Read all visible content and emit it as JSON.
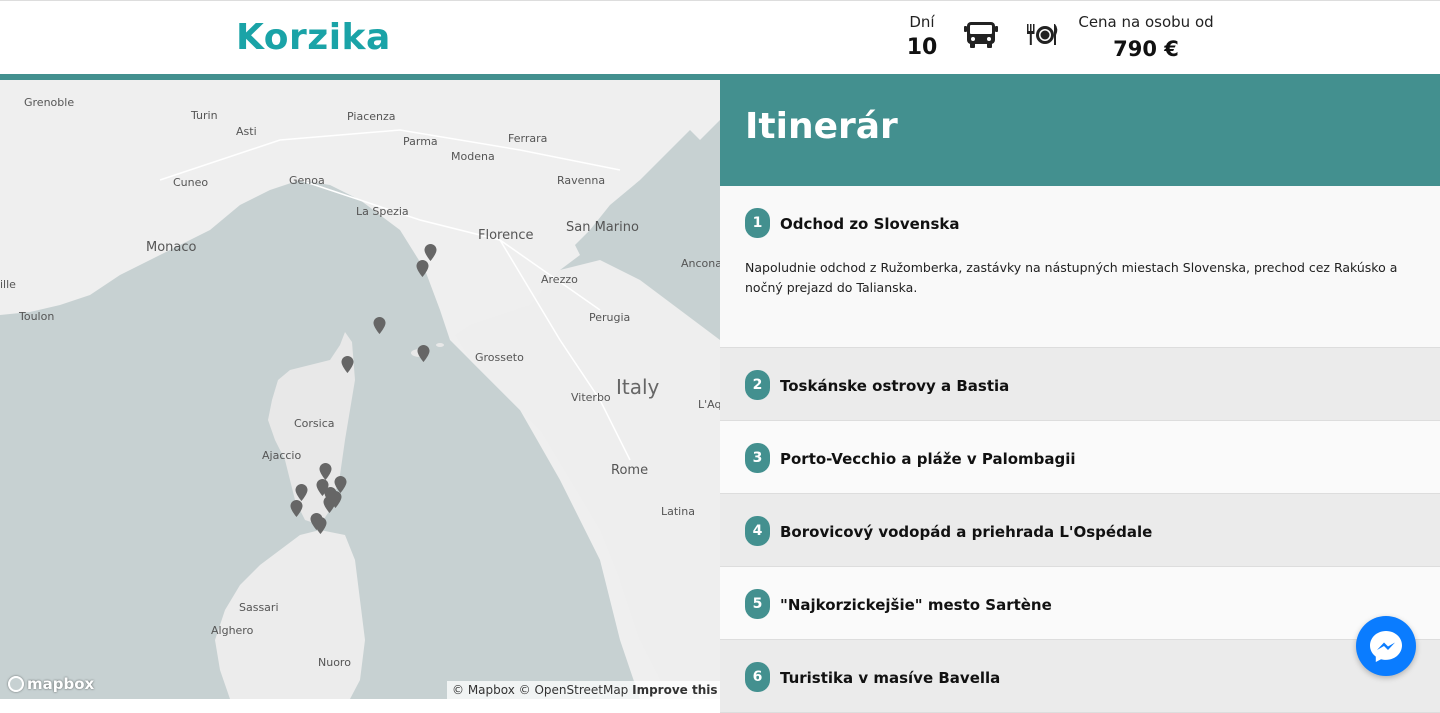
{
  "header": {
    "title": "Korzika",
    "days_label": "Dní",
    "days_value": "10",
    "transport_icon": "bus-icon",
    "meal_icon": "meal-icon",
    "price_label": "Cena na osobu od",
    "price_value": "790 €"
  },
  "map": {
    "labels": [
      {
        "text": "Grenoble"
      },
      {
        "text": "Turin"
      },
      {
        "text": "Asti"
      },
      {
        "text": "Cuneo"
      },
      {
        "text": "Piacenza"
      },
      {
        "text": "Parma"
      },
      {
        "text": "Modena"
      },
      {
        "text": "Ferrara"
      },
      {
        "text": "Ravenna"
      },
      {
        "text": "Genoa"
      },
      {
        "text": "La Spezia"
      },
      {
        "text": "Florence"
      },
      {
        "text": "San Marino"
      },
      {
        "text": "Monaco"
      },
      {
        "text": "Ancona"
      },
      {
        "text": "Arezzo"
      },
      {
        "text": "Toulon"
      },
      {
        "text": "Perugia"
      },
      {
        "text": "Grosseto"
      },
      {
        "text": "Italy"
      },
      {
        "text": "Viterbo"
      },
      {
        "text": "L'Aqui"
      },
      {
        "text": "Corsica"
      },
      {
        "text": "Ajaccio"
      },
      {
        "text": "Rome"
      },
      {
        "text": "Latina"
      },
      {
        "text": "Sassari"
      },
      {
        "text": "Alghero"
      },
      {
        "text": "Nuoro"
      },
      {
        "text": "ille"
      }
    ],
    "logo_text": "mapbox",
    "attribution": "© Mapbox © OpenStreetMap",
    "improve_link": "Improve this map"
  },
  "itinerary": {
    "heading": "Itinerár",
    "days": [
      {
        "num": "1",
        "title": "Odchod zo Slovenska",
        "desc": "Napoludnie odchod z Ružomberka, zastávky na nástupných miestach Slovenska, prechod cez Rakúsko a nočný prejazd do Talianska."
      },
      {
        "num": "2",
        "title": "Toskánske ostrovy a Bastia"
      },
      {
        "num": "3",
        "title": "Porto-Vecchio a pláže v Palombagii"
      },
      {
        "num": "4",
        "title": "Borovicový vodopád a priehrada L'Ospédale"
      },
      {
        "num": "5",
        "title": "\"Najkorzickejšie\" mesto Sartène"
      },
      {
        "num": "6",
        "title": "Turistika v masíve Bavella"
      }
    ]
  },
  "chat": {
    "icon": "messenger-icon"
  }
}
